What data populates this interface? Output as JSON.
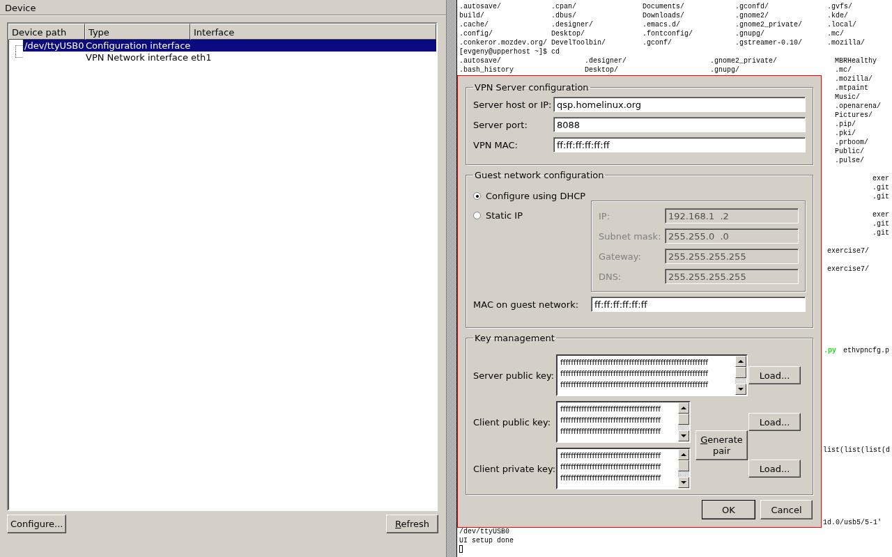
{
  "device_panel": {
    "title": "Device",
    "tree": {
      "columns": [
        "Device path",
        "Type",
        "Interface"
      ],
      "rows": [
        {
          "path": "/dev/ttyUSB0",
          "type": "Configuration interface",
          "selected": true
        },
        {
          "type": "VPN Network interface",
          "interface": "eth1",
          "selected": false
        }
      ]
    },
    "buttons": [
      {
        "label": "Configure...",
        "mnemonic_underlined": false
      },
      {
        "label": "Refresh",
        "mnemonic_underlined": true
      }
    ]
  },
  "terminal": {
    "lines": [
      [
        ".autosave/",
        ".cpan/",
        "Documents/",
        ".gconfd/",
        ".gvfs/"
      ],
      [
        "build/",
        ".dbus/",
        "Downloads/",
        ".gnome2/",
        ".kde/"
      ],
      [
        ".cache/",
        ".designer/",
        ".emacs.d/",
        ".gnome2_private/",
        ".local/"
      ],
      [
        ".config/",
        "Desktop/",
        ".fontconfig/",
        ".gnupg/",
        ".mc/"
      ],
      [
        ".conkeror.mozdev.org/",
        "DevelToolbin/",
        ".gconf/",
        ".gstreamer-0.10/",
        ".mozilla/"
      ],
      [
        "[evgeny@upperhost ~]$ cd"
      ],
      [
        ".autosave/",
        ".designer/",
        ".gnome2_private/",
        "MBRHealthy"
      ],
      [
        ".bash_history",
        "Desktop/",
        ".gnupg/",
        ".mc/"
      ],
      [
        ".mozilla/"
      ],
      [
        ".mtpaint"
      ],
      [
        "Music/"
      ],
      [
        ".openarena/"
      ],
      [
        "Pictures/"
      ],
      [
        ".pip/"
      ],
      [
        ".pki/"
      ],
      [
        ".prboom/"
      ],
      [
        "Public/"
      ],
      [
        ".pulse/"
      ],
      [
        "exer"
      ],
      [
        ".git"
      ],
      [
        ".git"
      ],
      [
        "exer"
      ],
      [
        ".git"
      ],
      [
        ".git"
      ],
      [
        "exercise7/"
      ],
      [
        "exercise7/"
      ],
      [
        {
          "text": ".py",
          "color": "#22dd22"
        },
        "ethvpncfg.p"
      ],
      [
        "list(list(list(d"
      ],
      [
        "1d.0/usb5/5-1'"
      ],
      [
        "/dev/ttyUSB0"
      ],
      [
        "UI setup done"
      ]
    ],
    "cursor": true
  },
  "dialog": {
    "server_group": {
      "title": "VPN Server configuration",
      "fields": [
        {
          "label": "Server host or IP:",
          "value": "qsp.homelinux.org"
        },
        {
          "label": "Server port:",
          "value": "8088"
        },
        {
          "label": "VPN MAC:",
          "value": "ff:ff:ff:ff:ff:ff"
        }
      ]
    },
    "guest_group": {
      "title": "Guest network configuration",
      "options": [
        {
          "label": "Configure using DHCP",
          "selected": true
        },
        {
          "label": "Static IP",
          "selected": false
        }
      ],
      "static_disabled": true,
      "static_fields": [
        {
          "label": "IP:",
          "value": "192.168.1  .2"
        },
        {
          "label": "Subnet mask:",
          "value": "255.255.0  .0"
        },
        {
          "label": "Gateway:",
          "value": "255.255.255.255"
        },
        {
          "label": "DNS:",
          "value": "255.255.255.255"
        }
      ],
      "mac": {
        "label": "MAC on guest network:",
        "value": "ff:ff:ff:ff:ff:ff"
      }
    },
    "key_group": {
      "title": "Key management",
      "keys": [
        {
          "label": "Server public key:",
          "text": "ffffffffffffffffffffffffffffffffffffffffffffffffffffffff\nffffffffffffffffffffffffffffffffffffffffffffffffffffffff\nffffffffffffffffffffffffffffffffffffffffffffffffffffffff",
          "button": "Load..."
        },
        {
          "label": "Client public key:",
          "text": "ffffffffffffffffffffffffffffffffffffff\nffffffffffffffffffffffffffffffffffffff\nffffffffffffffffffffffffffffffffffffff",
          "button": "Load..."
        },
        {
          "label": "Client private key:",
          "text": "ffffffffffffffffffffffffffffffffffffff\nffffffffffffffffffffffffffffffffffffff\nffffffffffffffffffffffffffffffffffffff",
          "button": "Load..."
        }
      ],
      "generate_button": {
        "label": "Generate pair",
        "mnemonic_underlined": true
      }
    },
    "buttons": [
      {
        "label": "OK",
        "default": true
      },
      {
        "label": "Cancel",
        "default": false
      }
    ]
  }
}
